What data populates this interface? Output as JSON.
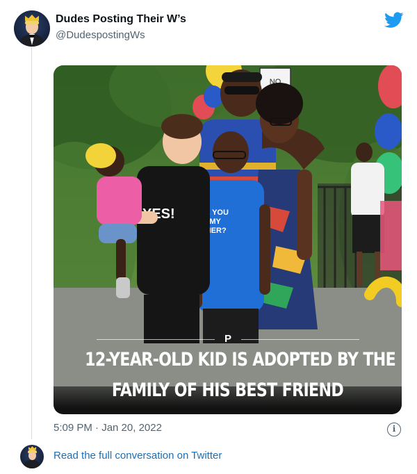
{
  "tweet": {
    "author_name": "Dudes Posting Their W’s",
    "author_handle": "@DudespostingWs",
    "timestamp": "5:09 PM · Jan 20, 2022",
    "read_more_label": "Read the full conversation on Twitter"
  },
  "media": {
    "sign_text": "NO",
    "boy_shirt_text": "YES!",
    "kid_shirt_text_1": "LL YOU",
    "kid_shirt_text_2": "E MY",
    "kid_shirt_text_3": "THER?",
    "caption_mark": "P",
    "caption_line_1": "12-YEAR-OLD KID IS ADOPTED BY THE",
    "caption_line_2": "FAMILY OF HIS BEST FRIEND"
  },
  "icons": {
    "brand": "twitter-bird-icon",
    "info": "info-icon",
    "info_glyph": "i"
  },
  "colors": {
    "twitter_blue": "#1d9bf0",
    "link": "#1d6fb5",
    "muted_text": "#536471"
  }
}
